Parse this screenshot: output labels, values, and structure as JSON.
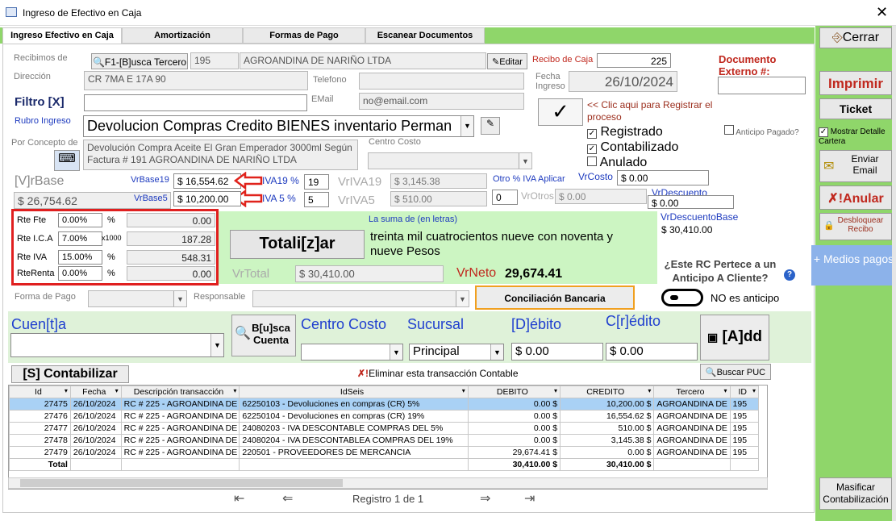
{
  "window": {
    "title": "Ingreso de Efectivo en Caja"
  },
  "tabs": [
    "Ingreso Efectivo en Caja",
    "Amortización",
    "Formas de Pago",
    "Escanear Documentos"
  ],
  "sidebar": {
    "cerrar": "Cerrar",
    "imprimir": "Imprimir",
    "ticket": "Ticket",
    "mostrar_detalle": "Mostrar Detalle Cartera",
    "enviar_email": "Enviar Email",
    "anular": "Anular",
    "desbloquear": "Desbloquear Recibo",
    "medios_pagos": "+ Medios pagos",
    "masificar": "Masificar Contabilización"
  },
  "header": {
    "recibimos_label": "Recibimos de",
    "busca_tercero": "F1-[B]usca Tercero",
    "tercero_id": "195",
    "tercero_name": "AGROANDINA DE NARIÑO LTDA",
    "editar": "Editar",
    "recibo_label": "Recibo de Caja",
    "recibo_value": "225",
    "documento_externo": "Documento Externo #:",
    "direccion_label": "Dirección",
    "direccion_value": "CR 7MA E 17A 90",
    "telefono_label": "Telefono",
    "fecha_label": "Fecha Ingreso",
    "fecha_value": "26/10/2024",
    "filtro_label": "Filtro [X]",
    "email_label": "EMail",
    "email_value": "no@email.com",
    "rubro_label": "Rubro Ingreso",
    "rubro_value": "Devolucion Compras Credito BIENES inventario Perman",
    "registrar_hint": "<< Clic aqui para Registrar el proceso",
    "registrado": "Registrado",
    "contabilizado": "Contabilizado",
    "anulado": "Anulado",
    "anticipo_pagado": "Anticipo Pagado?",
    "concepto_label": "Por Concepto de",
    "concepto_value": "Devolución Compra Aceite El Gran Emperador 3000ml Según Factura # 191 AGROANDINA DE NARIÑO LTDA",
    "centro_costo_label": "Centro Costo"
  },
  "values": {
    "vrbase_label": "[V]rBase",
    "vrbase_value": "$ 26,754.62",
    "vrbase19_label": "VrBase19",
    "vrbase19_value": "$ 16,554.62",
    "iva19_label": "IVA19 %",
    "iva19_value": "19",
    "vriva19_label": "VrIVA19",
    "vriva19_value": "$ 3,145.38",
    "otro_iva": "Otro % IVA Aplicar",
    "vrcosto_label": "VrCosto",
    "vrcosto_value": "$ 0.00",
    "vrbase5_label": "VrBase5",
    "vrbase5_value": "$ 10,200.00",
    "iva5_label": "IVA 5 %",
    "iva5_value": "5",
    "vriva5_label": "VrIVA5",
    "vriva5_value": "$ 510.00",
    "otro_value": "0",
    "vrotros_label": "VrOtros",
    "vrotros_value": "$ 0.00",
    "vrdescuento_label": "VrDescuento",
    "vrdescuento_value": "$ 0.00",
    "vrdescuentobase_label": "VrDescuentoBase",
    "vrdescuentobase_value": "$ 30,410.00"
  },
  "retenciones": [
    {
      "label": "Rte Fte",
      "pct": "0.00%",
      "sym": "%",
      "value": "0.00"
    },
    {
      "label": "Rte I.C.A",
      "pct": "7.00%",
      "sym": "x1000",
      "value": "187.28"
    },
    {
      "label": "Rte IVA",
      "pct": "15.00%",
      "sym": "%",
      "value": "548.31"
    },
    {
      "label": "RteRenta",
      "pct": "0.00%",
      "sym": "%",
      "value": "0.00"
    }
  ],
  "totals": {
    "suma_label": "La suma de (en letras)",
    "suma_text": "treinta mil cuatrocientos nueve con noventa y nueve Pesos",
    "totalizar": "Totali[z]ar",
    "vrtotal_label": "VrTotal",
    "vrtotal_value": "$ 30,410.00",
    "vrneto_label": "VrNeto",
    "vrneto_value": "29,674.41",
    "anticipo_question": "¿Este RC Pertece a un Anticipo A Cliente?",
    "no_anticipo": "NO es anticipo",
    "conciliacion": "Conciliación Bancaria",
    "forma_pago_label": "Forma de Pago",
    "responsable_label": "Responsable"
  },
  "entry": {
    "cuenta_label": "Cuen[t]a",
    "busca_cuenta": "B[u]sca Cuenta",
    "centro_costo": "Centro Costo",
    "sucursal": "Sucursal",
    "sucursal_value": "Principal",
    "debito": "[D]ébito",
    "debito_value": "$ 0.00",
    "credito": "C[r]édito",
    "credito_value": "$ 0.00",
    "add": "[A]dd",
    "contabilizar": "[S] Contabilizar",
    "eliminar": "Eliminar esta transacción Contable",
    "buscar_puc": "Buscar PUC"
  },
  "grid": {
    "headers": [
      "Id",
      "Fecha",
      "Descripción transacción",
      "IdSeis",
      "DEBITO",
      "CREDITO",
      "Tercero",
      "ID"
    ],
    "rows": [
      [
        "27475",
        "26/10/2024",
        "RC # 225 - AGROANDINA DE",
        "62250103 - Devoluciones en compras (CR) 5%",
        "0.00 $",
        "10,200.00 $",
        "AGROANDINA DE",
        "195"
      ],
      [
        "27476",
        "26/10/2024",
        "RC # 225 - AGROANDINA DE",
        "62250104 - Devoluciones en compras (CR) 19%",
        "0.00 $",
        "16,554.62 $",
        "AGROANDINA DE",
        "195"
      ],
      [
        "27477",
        "26/10/2024",
        "RC # 225 - AGROANDINA DE",
        "24080203 - IVA DESCONTABLE COMPRAS DEL 5%",
        "0.00 $",
        "510.00 $",
        "AGROANDINA DE",
        "195"
      ],
      [
        "27478",
        "26/10/2024",
        "RC # 225 - AGROANDINA DE",
        "24080204 - IVA DESCONTABLEA COMPRAS DEL 19%",
        "0.00 $",
        "3,145.38 $",
        "AGROANDINA DE",
        "195"
      ],
      [
        "27479",
        "26/10/2024",
        "RC # 225 - AGROANDINA DE",
        "220501 - PROVEEDORES DE MERCANCIA",
        "29,674.41 $",
        "0.00 $",
        "AGROANDINA DE",
        "195"
      ]
    ],
    "total_label": "Total",
    "total_debito": "30,410.00 $",
    "total_credito": "30,410.00 $",
    "registro": "Registro 1 de 1"
  }
}
